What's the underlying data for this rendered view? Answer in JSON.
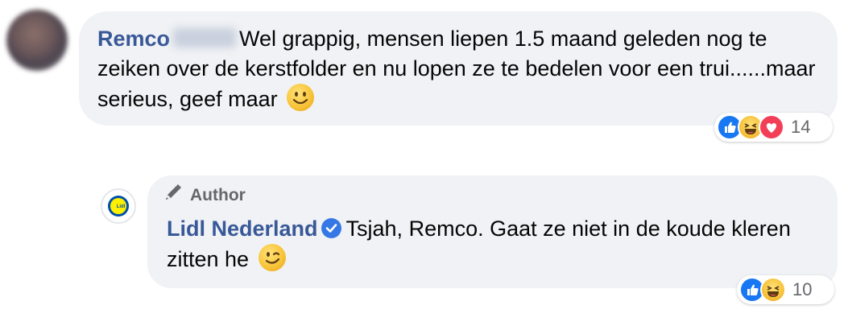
{
  "comment": {
    "author_name": "Remco",
    "text": "Wel grappig, mensen liepen 1.5 maand geleden nog te zeiken over de kerstfolder en nu lopen ze te bedelen voor een trui......maar serieus, geef maar",
    "reactions": {
      "icons": [
        "like-icon",
        "haha-icon",
        "love-icon"
      ],
      "count": "14"
    }
  },
  "reply": {
    "badge_label": "Author",
    "author_name": "Lidl Nederland",
    "avatar_text": "Lidl",
    "text": "Tsjah, Remco. Gaat ze niet in de koude kleren zitten he",
    "reactions": {
      "icons": [
        "like-icon",
        "haha-icon"
      ],
      "count": "10"
    }
  },
  "colors": {
    "name": "#385898",
    "bubble": "#f0f2f5",
    "like": "#1877f2",
    "love": "#f33e58",
    "verified": "#3578e5"
  }
}
